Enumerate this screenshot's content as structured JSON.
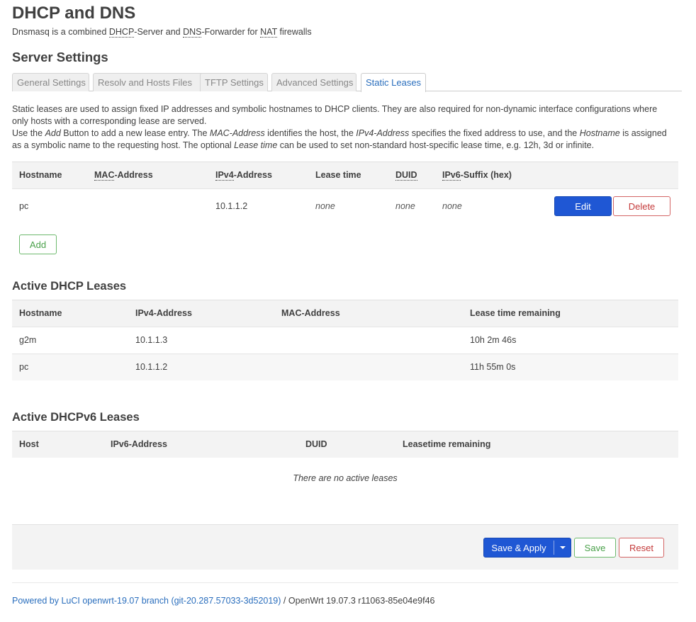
{
  "page": {
    "title": "DHCP and DNS",
    "subtitle_parts": {
      "a": "Dnsmasq is a combined ",
      "b": "DHCP",
      "c": "-Server and ",
      "d": "DNS",
      "e": "-Forwarder for ",
      "f": "NAT",
      "g": " firewalls"
    }
  },
  "server_settings": {
    "heading": "Server Settings",
    "tabs": [
      {
        "label": "General Settings",
        "active": false
      },
      {
        "label": "Resolv and Hosts Files",
        "active": false
      },
      {
        "label": "TFTP Settings",
        "active": false
      },
      {
        "label": "Advanced Settings",
        "active": false
      },
      {
        "label": "Static Leases",
        "active": true
      }
    ],
    "description": {
      "line1": "Static leases are used to assign fixed IP addresses and symbolic hostnames to DHCP clients. They are also required for non-dynamic interface configurations where only hosts with a corresponding lease are served.",
      "p2a": "Use the ",
      "p2_add": "Add",
      "p2b": " Button to add a new lease entry. The ",
      "p2_mac": "MAC-Address",
      "p2c": " identifies the host, the ",
      "p2_ipv4": "IPv4-Address",
      "p2d": " specifies the fixed address to use, and the ",
      "p2_host": "Hostname",
      "p2e": " is assigned as a symbolic name to the requesting host. The optional ",
      "p2_lease": "Lease time",
      "p2f": " can be used to set non-standard host-specific lease time, e.g. 12h, 3d or infinite."
    }
  },
  "static_leases": {
    "headers": {
      "hostname": "Hostname",
      "mac_abbr": "MAC",
      "mac_rest": "-Address",
      "ipv4_abbr": "IPv4",
      "ipv4_rest": "-Address",
      "lease": "Lease time",
      "duid": "DUID",
      "ipv6_abbr": "IPv6",
      "ipv6_rest": "-Suffix (hex)"
    },
    "rows": [
      {
        "hostname": "pc",
        "mac": "",
        "ipv4": "10.1.1.2",
        "lease": "none",
        "duid": "none",
        "ipv6": "none"
      }
    ],
    "edit_label": "Edit",
    "delete_label": "Delete",
    "add_label": "Add"
  },
  "dhcp_leases": {
    "heading": "Active DHCP Leases",
    "headers": {
      "hostname": "Hostname",
      "ipv4": "IPv4-Address",
      "mac": "MAC-Address",
      "remaining": "Lease time remaining"
    },
    "rows": [
      {
        "hostname": "g2m",
        "ipv4": "10.1.1.3",
        "mac": "",
        "remaining": "10h 2m 46s"
      },
      {
        "hostname": "pc",
        "ipv4": "10.1.1.2",
        "mac": "",
        "remaining": "11h 55m 0s"
      }
    ]
  },
  "dhcpv6_leases": {
    "heading": "Active DHCPv6 Leases",
    "headers": {
      "host": "Host",
      "ipv6": "IPv6-Address",
      "duid": "DUID",
      "remaining": "Leasetime remaining"
    },
    "empty_text": "There are no active leases"
  },
  "actions": {
    "save_apply": "Save & Apply",
    "dropdown_icon": "caret-down-icon",
    "save": "Save",
    "reset": "Reset"
  },
  "footer": {
    "link": "Powered by LuCI openwrt-19.07 branch (git-20.287.57033-3d52019)",
    "rest": " / OpenWrt 19.07.3 r11063-85e04e9f46"
  },
  "colors": {
    "primary": "#1f57d4",
    "link": "#2a6ebd",
    "negative": "#c43a3a",
    "positive": "#49a049"
  }
}
